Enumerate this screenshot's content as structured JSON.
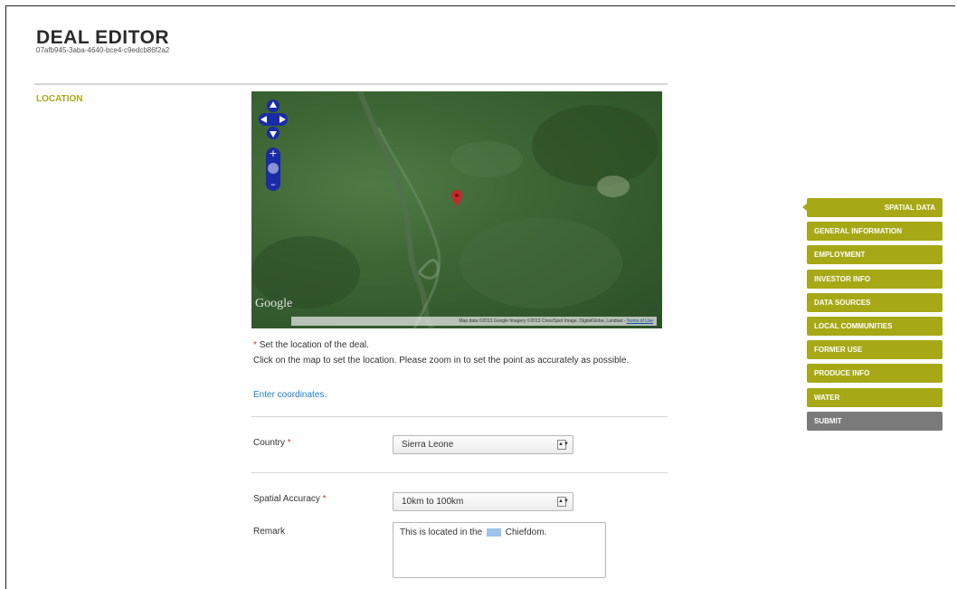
{
  "header": {
    "title": "DEAL EDITOR",
    "deal_id": "07afb945-3aba-4640-bce4-c9edcb86f2a2"
  },
  "section": {
    "label": "LOCATION"
  },
  "map": {
    "logo": "Google",
    "attribution": "Map data ©2013 Google Imagery ©2013 Cnes/Spot Image, DigitalGlobe, Landsat - ",
    "terms_link": "Terms of Use"
  },
  "instructions": {
    "required_marker": "*",
    "required_text": "Set the location of the deal.",
    "help": "Click on the map to set the location. Please zoom in to set the point as accurately as possible.",
    "coords_link": "Enter coordinates."
  },
  "form": {
    "country_label": "Country",
    "country_value": "Sierra Leone",
    "accuracy_label": "Spatial Accuracy",
    "accuracy_value": "10km to 100km",
    "remark_label": "Remark",
    "remark_before": "This is located in the",
    "remark_after": "Chiefdom."
  },
  "nav": {
    "items": [
      {
        "label": "SPATIAL DATA"
      },
      {
        "label": "GENERAL INFORMATION"
      },
      {
        "label": "EMPLOYMENT"
      },
      {
        "label": "INVESTOR INFO"
      },
      {
        "label": "DATA SOURCES"
      },
      {
        "label": "LOCAL COMMUNITIES"
      },
      {
        "label": "FORMER USE"
      },
      {
        "label": "PRODUCE INFO"
      },
      {
        "label": "WATER"
      }
    ],
    "submit_label": "SUBMIT"
  },
  "colors": {
    "accent": "#a7a816",
    "submit": "#7a7a7a",
    "link": "#1d7fc4",
    "map_control": "#1b2aa6"
  },
  "icons": [
    "pan-control-icon",
    "zoom-in-icon",
    "zoom-out-icon",
    "map-marker-icon",
    "select-arrow-icon"
  ]
}
